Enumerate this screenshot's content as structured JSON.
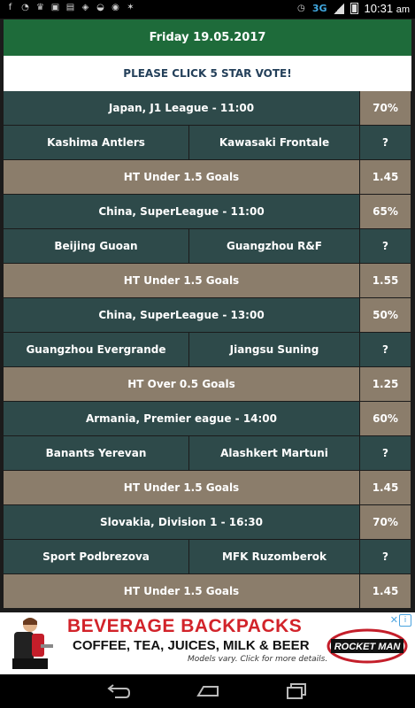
{
  "status_bar": {
    "network": "3G",
    "time": "10:31",
    "time_suffix": "am"
  },
  "header": {
    "date": "Friday 19.05.2017",
    "vote_banner": "PLEASE CLICK 5 STAR VOTE!"
  },
  "matches": [
    {
      "league": "Japan, J1 League - 11:00",
      "percent": "70%",
      "home": "Kashima Antlers",
      "away": "Kawasaki Frontale",
      "result": "?",
      "tip": "HT Under 1.5 Goals",
      "odds": "1.45"
    },
    {
      "league": "China, SuperLeague - 11:00",
      "percent": "65%",
      "home": "Beijing Guoan",
      "away": "Guangzhou R&F",
      "result": "?",
      "tip": "HT Under 1.5 Goals",
      "odds": "1.55"
    },
    {
      "league": "China, SuperLeague - 13:00",
      "percent": "50%",
      "home": "Guangzhou Evergrande",
      "away": "Jiangsu Suning",
      "result": "?",
      "tip": "HT Over 0.5 Goals",
      "odds": "1.25"
    },
    {
      "league": "Armania, Premier eague - 14:00",
      "percent": "60%",
      "home": "Banants Yerevan",
      "away": "Alashkert Martuni",
      "result": "?",
      "tip": "HT Under 1.5 Goals",
      "odds": "1.45"
    },
    {
      "league": "Slovakia, Division 1 - 16:30",
      "percent": "70%",
      "home": "Sport Podbrezova",
      "away": "MFK Ruzomberok",
      "result": "?",
      "tip": "HT Under 1.5 Goals",
      "odds": "1.45"
    }
  ],
  "ad": {
    "title": "BEVERAGE BACKPACKS",
    "subtitle": "COFFEE, TEA, JUICES, MILK & BEER",
    "fineprint": "Models vary. Click for more details.",
    "brand": "ROCKET MAN",
    "info_icon": "info-icon",
    "close_glyph": "✕"
  },
  "colors": {
    "date_bar": "#1e6b3a",
    "row_teal": "#2e4a4a",
    "row_brown": "#8b7d6b",
    "ad_red": "#d2232a"
  }
}
